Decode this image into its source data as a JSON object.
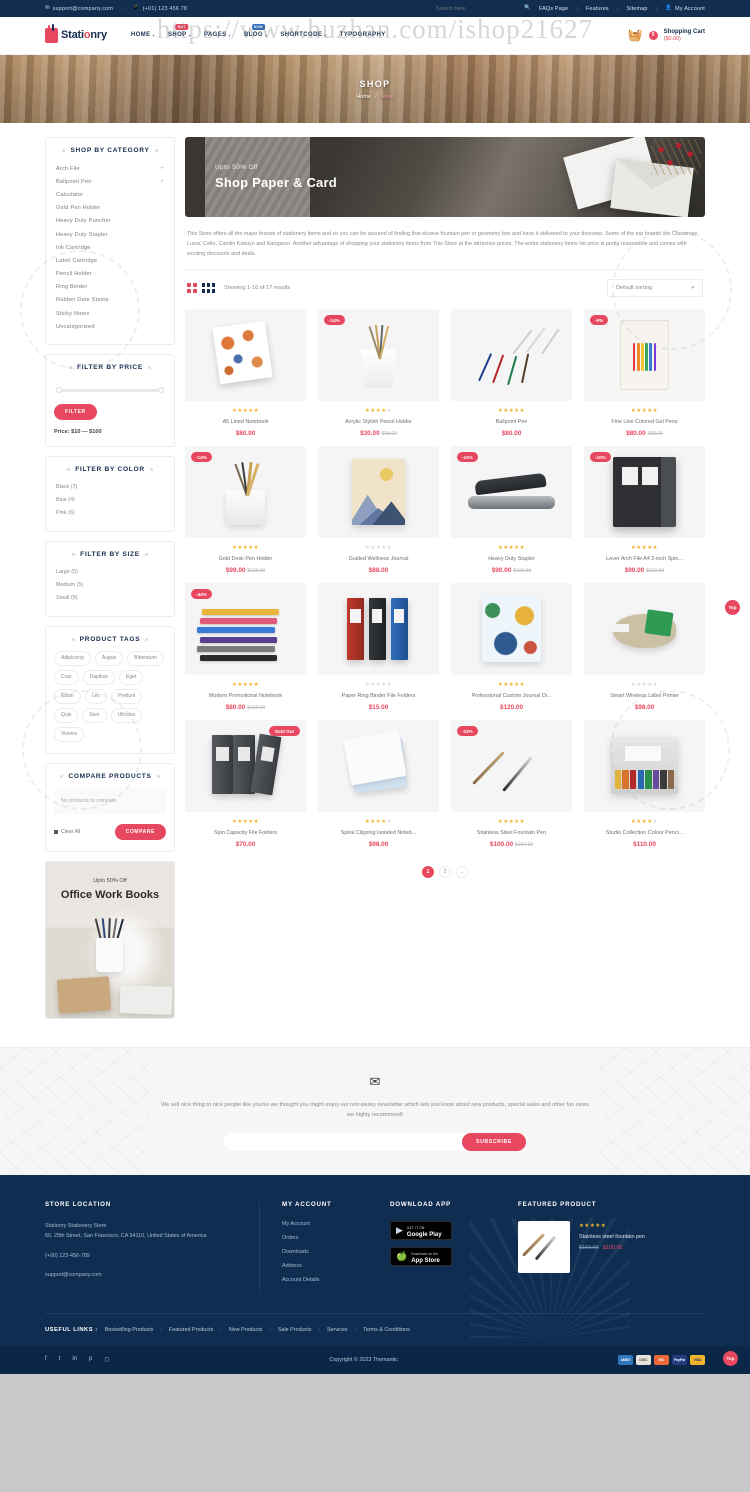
{
  "watermark": "https://www.huzhan.com/ishop21627",
  "topbar": {
    "email": "support@company.com",
    "phone": "(+01) 123 456 78",
    "search_placeholder": "Search here",
    "links": [
      "FAQs Page",
      "Features",
      "Sitemap"
    ],
    "account": "My Account"
  },
  "header": {
    "logo_first": "Stati",
    "logo_accent": "o",
    "logo_last": "nry",
    "nav": [
      {
        "label": "HOME",
        "caret": "▾",
        "badge": ""
      },
      {
        "label": "SHOP",
        "caret": "▾",
        "badge": "HOT"
      },
      {
        "label": "PAGES",
        "caret": "▾",
        "badge": ""
      },
      {
        "label": "BLOG",
        "caret": "▾",
        "badge": "NEW"
      },
      {
        "label": "SHORTCODE",
        "caret": "▾",
        "badge": ""
      },
      {
        "label": "TYPOGRAPHY",
        "caret": "",
        "badge": ""
      }
    ],
    "cart_count": "0",
    "cart_label": "Shopping Cart",
    "cart_total": "($0.00)"
  },
  "page_banner": {
    "title": "SHOP",
    "crumb_home": "Home",
    "crumb_sep": "/",
    "crumb_current": "Shop"
  },
  "sidebar": {
    "category_title": "SHOP BY CATEGORY",
    "categories": [
      {
        "label": "Arch File",
        "expandable": true
      },
      {
        "label": "Ballpoint Pen",
        "expandable": true
      },
      {
        "label": "Calculator",
        "expandable": false
      },
      {
        "label": "Gold Pen Holder",
        "expandable": false
      },
      {
        "label": "Heavy Duty Puncher",
        "expandable": false
      },
      {
        "label": "Heavy Duty Stapler",
        "expandable": false
      },
      {
        "label": "Ink Cartridge",
        "expandable": false
      },
      {
        "label": "Label Cartridge",
        "expandable": false
      },
      {
        "label": "Pencil Holder",
        "expandable": false
      },
      {
        "label": "Ring Binder",
        "expandable": false
      },
      {
        "label": "Rubber Date Stamp",
        "expandable": false
      },
      {
        "label": "Sticky Notes",
        "expandable": false
      },
      {
        "label": "Uncategorized",
        "expandable": false
      }
    ],
    "price_title": "FILTER BY PRICE",
    "filter_button": "FILTER",
    "price_range": "Price: $10 — $100",
    "color_title": "FILTER BY COLOR",
    "colors": [
      "Black  (7)",
      "Blue  (4)",
      "Pink  (6)"
    ],
    "size_title": "FILTER BY SIZE",
    "sizes": [
      "Large  (5)",
      "Medium  (5)",
      "Small  (6)"
    ],
    "tags_title": "PRODUCT TAGS",
    "tags": [
      "Adipiscing",
      "Augue",
      "Bibendum",
      "Cras",
      "Dapibus",
      "Eget",
      "Etiam",
      "Leo",
      "Pretium",
      "Quis",
      "Sem",
      "Ultricies",
      "Viverra"
    ],
    "compare_title": "COMPARE PRODUCTS",
    "compare_empty": "No products to compare",
    "clear_all": "Clear All",
    "compare_button": "COMPARE",
    "promo_small": "Upto 50% Off",
    "promo_big": "Office Work Books"
  },
  "main": {
    "banner_small": "Upto 50% Off",
    "banner_big": "Shop Paper & Card",
    "description": "This Store offers all the major brands of stationery items and so you can be assured of finding that elusive fountain pen or geometry box and have it delivered to your doorstep. Some of the top brands are Classmate, Luxor, Cello, Camlin Kokuyo and Kangaroo. Another advantage of shopping your stationery items from This Store at the attractive prices. The entire stationery items list price is pretty reasonable and comes with exciting discounts and deals.",
    "showing": "Showing 1-16 of 17 results",
    "sorting": "Default sorting",
    "pagination": [
      "1",
      "2",
      "→"
    ],
    "products": [
      {
        "name": "A5 Lined Notebook",
        "price": "$80.00",
        "old": "",
        "badge": "",
        "stars": 5,
        "rated": true
      },
      {
        "name": "Acrylic Stylish Pencil Holder",
        "price": "$30.00",
        "old": "$35.00",
        "badge": "-14%",
        "stars": 4,
        "rated": true
      },
      {
        "name": "Ballpoint Pen",
        "price": "$80.00",
        "old": "",
        "badge": "",
        "stars": 5,
        "rated": true
      },
      {
        "name": "Fine Line Colored Gel Pens",
        "price": "$80.00",
        "old": "$88.00",
        "badge": "-9%",
        "stars": 5,
        "rated": true
      },
      {
        "name": "Gold Desk Pen Holder",
        "price": "$99.00",
        "old": "$115.00",
        "badge": "-14%",
        "stars": 5,
        "rated": true
      },
      {
        "name": "Guided Wellness Journal",
        "price": "$88.00",
        "old": "",
        "badge": "",
        "stars": 0,
        "rated": false
      },
      {
        "name": "Heavy Duty Stapler",
        "price": "$90.00",
        "old": "$100.00",
        "badge": "-10%",
        "stars": 5,
        "rated": true
      },
      {
        "name": "Lever Arch File A4 2-inch Spin...",
        "price": "$90.00",
        "old": "$100.00",
        "badge": "-10%",
        "stars": 5,
        "rated": true
      },
      {
        "name": "Modern Promotional Notebook",
        "price": "$80.00",
        "old": "$100.00",
        "badge": "-44%",
        "stars": 5,
        "rated": true
      },
      {
        "name": "Paper Ring Binder File Folders",
        "price": "$15.00",
        "old": "",
        "badge": "",
        "stars": 0,
        "rated": false
      },
      {
        "name": "Professional Custom Journal Di...",
        "price": "$120.00",
        "old": "",
        "badge": "",
        "stars": 5,
        "rated": true
      },
      {
        "name": "Smart Wireless Label Printer",
        "price": "$98.00",
        "old": "",
        "badge": "",
        "stars": 0,
        "rated": false
      },
      {
        "name": "Spin Capacity File Folders",
        "price": "$70.00",
        "old": "",
        "badge": "Sold Out",
        "stars": 5,
        "rated": true
      },
      {
        "name": "Spiral Clipping Isolated Noteb...",
        "price": "$98.00",
        "old": "",
        "badge": "",
        "stars": 4,
        "rated": true
      },
      {
        "name": "Stainless Steel Fountain Pen",
        "price": "$100.00",
        "old": "$150.00",
        "badge": "-33%",
        "stars": 5,
        "rated": true
      },
      {
        "name": "Studio Collection Colour Penci...",
        "price": "$110.00",
        "old": "",
        "badge": "",
        "stars": 4,
        "rated": true
      }
    ]
  },
  "newsletter": {
    "text": "We sell nice thing to nice people like you!so we thought you might enjoy our non-pesky newsletter which lets you know about new products, special sales and other fun news we highly recommend!",
    "placeholder": "",
    "button": "SUBSCRIBE"
  },
  "footer": {
    "store_title": "STORE LOCATION",
    "store_name": "Stationry Stationery Store",
    "store_address": "60, 29th Street, San Francisco, CA 94110, United States of America",
    "store_phone": "(+00) 123-456-789",
    "store_email": "support@company.com",
    "account_title": "MY ACCOUNT",
    "account_links": [
      "My Account",
      "Orders",
      "Downloads",
      "Address",
      "Account Details"
    ],
    "download_title": "DOWNLOAD APP",
    "google_small": "GET IT ON",
    "google_big": "Google Play",
    "apple_small": "Download on the",
    "apple_big": "App Store",
    "featured_title": "FEATURED PRODUCT",
    "featured_name": "Stainless steel fountain pen",
    "featured_old": "$150.00",
    "featured_new": "$100.00",
    "useful_label": "USEFUL LINKS :",
    "useful_links": [
      "Bestselling Products",
      "Featured Products",
      "New Products",
      "Sale Products",
      "Services",
      "Terms & Conditions"
    ],
    "copyright": "Copyright © 2023 Themantic",
    "payments": [
      "AMEX",
      "DISC",
      "MC",
      "PayPal",
      "VISA"
    ],
    "to_top": "Top"
  }
}
